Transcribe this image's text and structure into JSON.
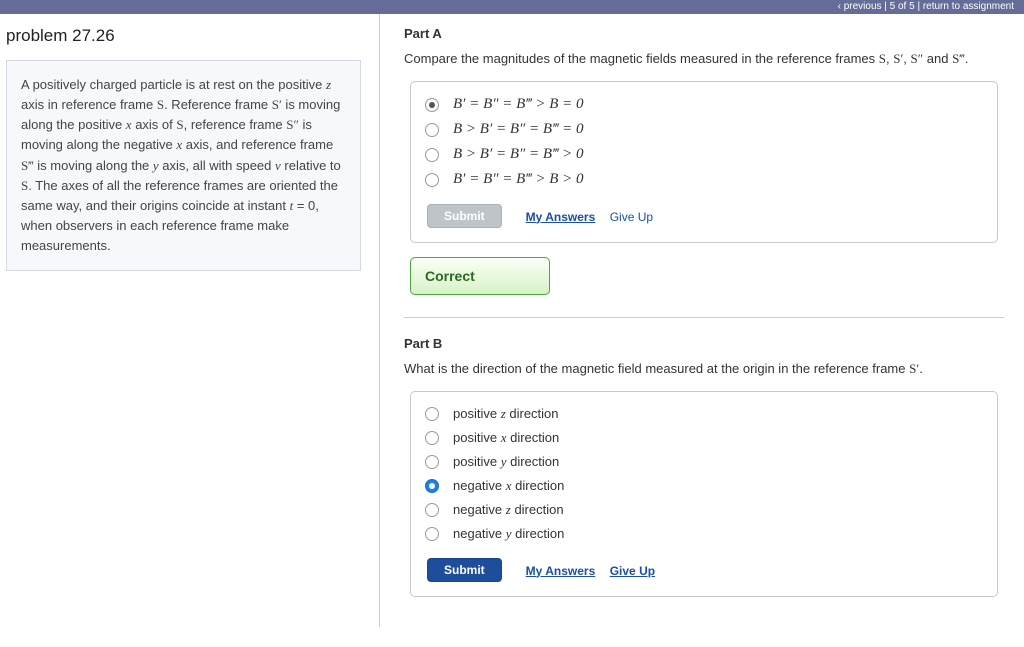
{
  "topnav": "‹ previous   |   5 of 5   |   return to assignment",
  "problem": {
    "title": "problem 27.26",
    "statement_html": "A positively charged particle is at rest on the positive <span class='ff it'>z</span> axis in reference frame <span class='ff'>S</span>. Reference frame <span class='ff'>S′</span> is moving along the positive <span class='ff it'>x</span> axis of <span class='ff'>S</span>, reference frame <span class='ff'>S″</span> is moving along the negative <span class='ff it'>x</span> axis, and reference frame <span class='ff'>S‴</span> is moving along the <span class='ff it'>y</span> axis, all with speed <span class='ff it'>v</span> relative to <span class='ff'>S</span>. The axes of all the reference frames are oriented the same way, and their origins coincide at instant <span class='ff it'>t</span> = 0, when observers in each reference frame make measurements."
  },
  "partA": {
    "label": "Part A",
    "question_html": "Compare the magnitudes of the magnetic fields measured in the reference frames <span class='ff'>S</span>, <span class='ff'>S′</span>, <span class='ff'>S″</span> and <span class='ff'>S‴</span>.",
    "choices": [
      "B′ = B″ = B‴ > B = 0",
      "B > B′ = B″ = B‴ = 0",
      "B > B′ = B″ = B‴ > 0",
      "B′ = B″ = B‴ > B > 0"
    ],
    "selected": 0,
    "submit": "Submit",
    "myanswers": "My Answers",
    "giveup": "Give Up",
    "correct": "Correct"
  },
  "partB": {
    "label": "Part B",
    "question_html": "What is the direction of the magnetic field measured at the origin in the reference frame <span class='ff'>S′</span>.",
    "choices": [
      "positive z direction",
      "positive x direction",
      "positive y direction",
      "negative x direction",
      "negative z direction",
      "negative y direction"
    ],
    "selected": 3,
    "submit": "Submit",
    "myanswers": "My Answers",
    "giveup": "Give Up"
  }
}
